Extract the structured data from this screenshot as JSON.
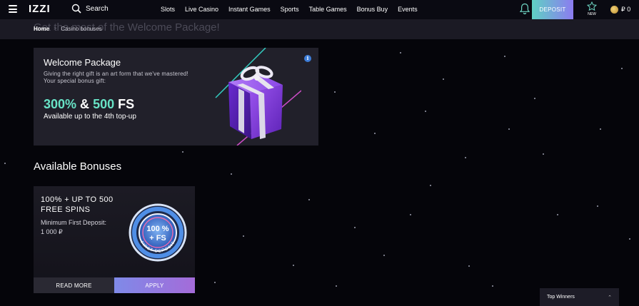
{
  "header": {
    "logo": "IZZI",
    "search_label": "Search",
    "nav": [
      "Slots",
      "Live Casino",
      "Instant Games",
      "Sports",
      "Table Games",
      "Bonus Buy",
      "Events"
    ],
    "deposit_label": "DEPOSIT",
    "new_label": "NEW",
    "balance": "₽ 0"
  },
  "banner": {
    "title": "Get the most of the Welcome Package!"
  },
  "breadcrumb": {
    "home": "Home",
    "separator": ">",
    "current": "Casino bonuses"
  },
  "welcome": {
    "title": "Welcome Package",
    "description_line1": "Giving the right gift is an art form that we've mastered!",
    "description_line2": "Your special bonus gift:",
    "offer_part1": "300%",
    "offer_and": " & ",
    "offer_part2": "500",
    "offer_fs": " FS",
    "availability": "Available up to the 4th top-up",
    "info_icon": "i"
  },
  "available_bonuses": {
    "heading": "Available Bonuses",
    "cards": [
      {
        "title": "100% + UP TO 500 FREE SPINS",
        "min_label": "Minimum First Deposit:",
        "min_value": "1 000 ₽",
        "badge_text_top": "100 %",
        "badge_text_bottom": "+ FS",
        "badge_ring_text": "FIRST DEPOSIT",
        "read_more": "READ MORE",
        "apply": "APPLY"
      }
    ]
  },
  "top_winners": {
    "label": "Top Winners"
  },
  "colors": {
    "accent_green": "#68e3c6",
    "deposit_gradient_start": "#5fd1c4",
    "deposit_gradient_end": "#8c7bf0",
    "apply_gradient_start": "#7f8ae8",
    "apply_gradient_end": "#a46bd9",
    "card_bg": "#21202a"
  },
  "icons": {
    "menu": "hamburger-icon",
    "search": "search-icon",
    "notifications": "bell-icon",
    "favorites": "star-icon",
    "currency": "coin-icon",
    "info": "info-icon",
    "top_winners_toggle": "chevron-up-icon"
  }
}
